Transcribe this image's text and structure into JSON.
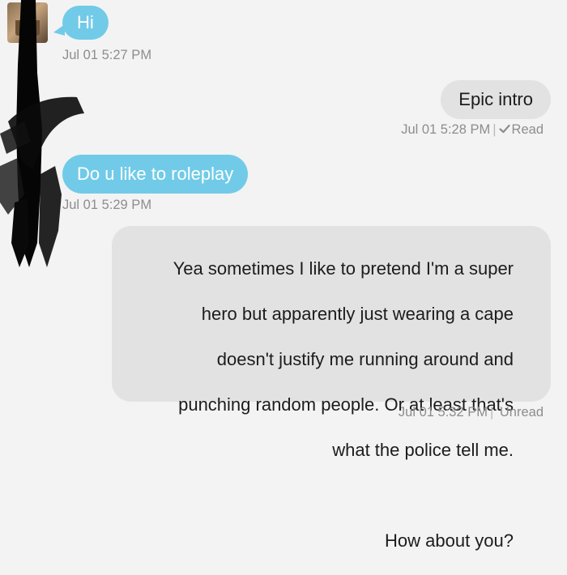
{
  "conversation": {
    "messages": [
      {
        "direction": "incoming",
        "text": "Hi",
        "timestamp": "Jul 01 5:27 PM"
      },
      {
        "direction": "outgoing",
        "text": "Epic intro",
        "timestamp": "Jul 01 5:28 PM",
        "status": "Read"
      },
      {
        "direction": "incoming",
        "text": "Do u like to roleplay",
        "timestamp": "Jul 01 5:29 PM"
      },
      {
        "direction": "outgoing",
        "text_lines": [
          "Yea sometimes I like to pretend I'm a super",
          "hero but apparently just wearing a cape",
          "doesn't justify me running around and",
          "punching random people. Or at least that's",
          "what the police tell me.",
          "",
          "How about you?"
        ],
        "timestamp": "Jul 01 5:32 PM",
        "status": "Unread"
      }
    ]
  },
  "colors": {
    "background": "#f3f3f3",
    "incoming_bubble": "#71cbe8",
    "outgoing_bubble": "#e2e2e2",
    "meta_text": "#8d8d8d"
  },
  "icons": {
    "read_receipt": "checkmark-icon",
    "avatar": "contact-avatar"
  }
}
